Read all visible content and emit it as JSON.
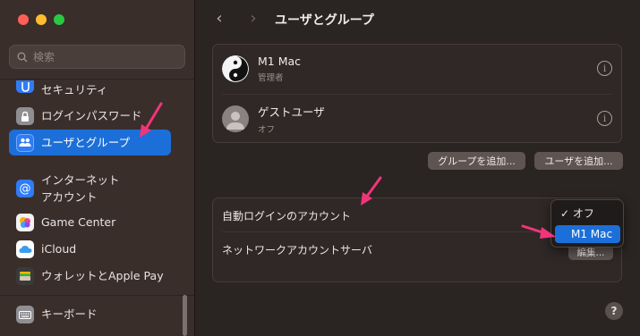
{
  "sidebar": {
    "search_placeholder": "検索",
    "items": [
      {
        "label": "セキュリティ",
        "icon": "hand-icon",
        "color": "#2f7cf6"
      },
      {
        "label": "ログインパスワード",
        "icon": "lock-icon",
        "color": "#8e8e93"
      },
      {
        "label": "ユーザとグループ",
        "icon": "users-icon",
        "color": "#2f7cf6"
      },
      {
        "label_line1": "インターネット",
        "label_line2": "アカウント",
        "icon": "at-icon",
        "color": "#2f7cf6"
      },
      {
        "label": "Game Center",
        "icon": "game-center-icon"
      },
      {
        "label": "iCloud",
        "icon": "icloud-icon",
        "color": "#ffffff"
      },
      {
        "label": "ウォレットとApple Pay",
        "icon": "wallet-icon",
        "color": "#3a3a3a"
      },
      {
        "label": "キーボード",
        "icon": "keyboard-icon",
        "color": "#8e8e93"
      }
    ]
  },
  "header": {
    "back": "‹",
    "forward": "›",
    "title": "ユーザとグループ"
  },
  "users": [
    {
      "name": "M1 Mac",
      "role": "管理者",
      "avatar": "yin-yang-icon"
    },
    {
      "name": "ゲストユーザ",
      "role": "オフ",
      "avatar": "person-icon"
    }
  ],
  "buttons": {
    "add_group": "グループを追加...",
    "add_user": "ユーザを追加...",
    "edit": "編集..."
  },
  "settings": {
    "auto_login_label": "自動ログインのアカウント",
    "network_server_label": "ネットワークアカウントサーバ"
  },
  "popup": {
    "options": [
      {
        "label": "✓ オフ",
        "selected": false
      },
      {
        "label": "M1 Mac",
        "selected": true
      }
    ]
  },
  "help": "?",
  "colors": {
    "accent": "#1c6fd8",
    "annotation": "#f0357a"
  }
}
